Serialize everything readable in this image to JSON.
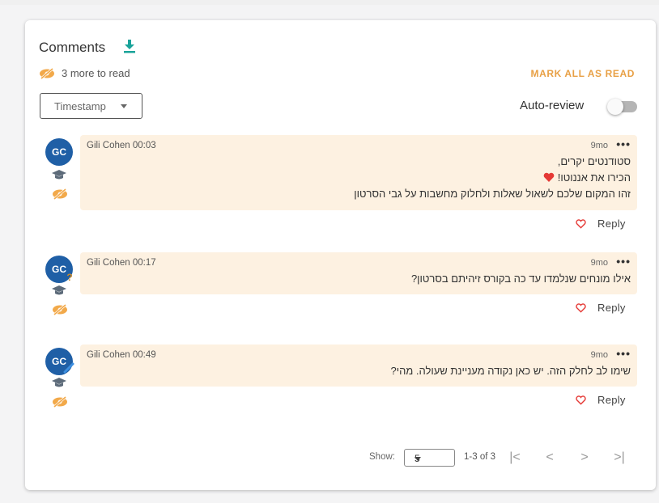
{
  "header": {
    "title": "Comments",
    "unread_text": "3 more to read",
    "mark_all_label": "MARK ALL AS READ"
  },
  "controls": {
    "sort_value": "Timestamp",
    "autoreview_label": "Auto-review",
    "autoreview_on": false
  },
  "comments": [
    {
      "initials": "GC",
      "author": "Gili Cohen 00:03",
      "age": "9mo",
      "lines": [
        "סטודנטים יקרים,",
        "הכירו את אננוטו!",
        "זהו המקום שלכם לשאול שאלות ולחלוק מחשבות על גבי הסרטון"
      ],
      "reply_label": "Reply"
    },
    {
      "initials": "GC",
      "author": "Gili Cohen 00:17",
      "age": "9mo",
      "lines": [
        "אילו מונחים שנלמדו עד כה בקורס זיהיתם בסרטון?"
      ],
      "reply_label": "Reply"
    },
    {
      "initials": "GC",
      "author": "Gili Cohen 00:49",
      "age": "9mo",
      "lines": [
        "שימו לב לחלק הזה. יש כאן נקודה מעניינת שעולה. מהי?"
      ],
      "reply_label": "Reply"
    }
  ],
  "pagination": {
    "show_label": "Show:",
    "page_size": "5",
    "range": "1-3 of 3",
    "first": "|<",
    "prev": "<",
    "next": ">",
    "last": ">|"
  },
  "colors": {
    "accent": "#e8a045",
    "avatar": "#1f5fa6",
    "bubble": "#fdf1e1",
    "download": "#1aa39a",
    "heart": "#e53935"
  },
  "icons": [
    "download-icon",
    "eye-off-icon",
    "graduation-cap-icon",
    "heart-icon",
    "more-icon"
  ]
}
